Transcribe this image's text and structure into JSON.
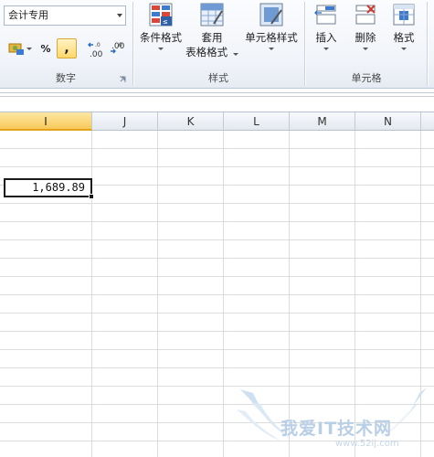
{
  "ribbon": {
    "number_group": {
      "format_combo_value": "会计专用",
      "percent_label": "%",
      "comma_label": ",",
      "increase_decimal_label": ".00",
      "decrease_decimal_label": ".00",
      "group_label": "数字"
    },
    "styles_group": {
      "conditional_format_label": "条件格式",
      "table_format_label_1": "套用",
      "table_format_label_2": "表格格式",
      "cell_styles_label": "单元格样式",
      "group_label": "样式"
    },
    "cells_group": {
      "insert_label": "插入",
      "delete_label": "删除",
      "format_label": "格式",
      "group_label": "单元格"
    }
  },
  "sheet": {
    "columns": [
      "I",
      "J",
      "K",
      "L",
      "M",
      "N"
    ],
    "selected_column": "I",
    "active_cell_value": "1,689.89"
  },
  "watermark": {
    "text": "我爱IT技术网",
    "url": "www.52ij.com"
  },
  "colors": {
    "selected_header": "#f8c95a",
    "gridline": "#dadcdd",
    "ribbon_bg": "#f1f4f9"
  }
}
